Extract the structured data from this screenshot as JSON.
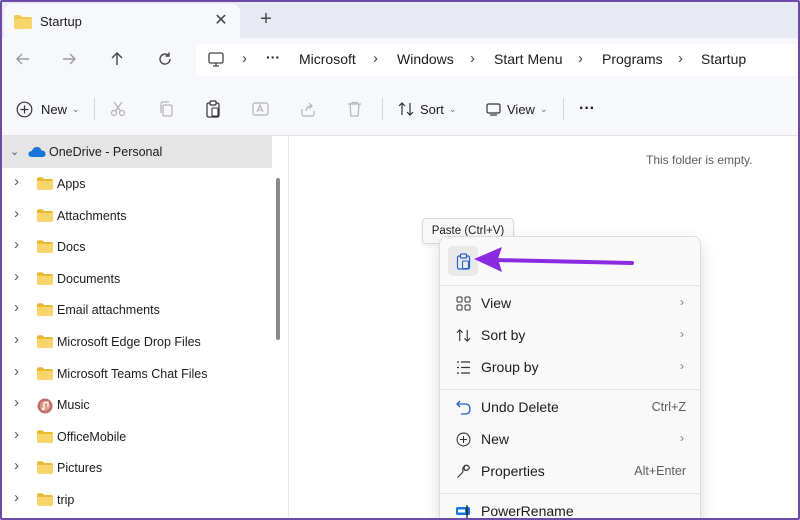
{
  "tab": {
    "title": "Startup",
    "close": "✕",
    "add": "+"
  },
  "nav": {
    "more": "···",
    "breadcrumb": [
      "Microsoft",
      "Windows",
      "Start Menu",
      "Programs",
      "Startup"
    ]
  },
  "toolbar": {
    "new_label": "New",
    "sort_label": "Sort",
    "view_label": "View",
    "more_label": "···"
  },
  "sidebar": {
    "root": "OneDrive - Personal",
    "items": [
      {
        "label": "Apps",
        "icon": "folder-icon"
      },
      {
        "label": "Attachments",
        "icon": "folder-icon"
      },
      {
        "label": "Docs",
        "icon": "folder-icon"
      },
      {
        "label": "Documents",
        "icon": "folder-icon"
      },
      {
        "label": "Email attachments",
        "icon": "folder-icon"
      },
      {
        "label": "Microsoft Edge Drop Files",
        "icon": "folder-icon"
      },
      {
        "label": "Microsoft Teams Chat Files",
        "icon": "folder-icon"
      },
      {
        "label": "Music",
        "icon": "music-icon"
      },
      {
        "label": "OfficeMobile",
        "icon": "folder-icon"
      },
      {
        "label": "Pictures",
        "icon": "folder-icon"
      },
      {
        "label": "trip",
        "icon": "folder-icon"
      }
    ]
  },
  "content": {
    "empty_message": "This folder is empty."
  },
  "tooltip": {
    "text": "Paste (Ctrl+V)"
  },
  "context_menu": {
    "items": [
      {
        "label": "View",
        "submenu": true
      },
      {
        "label": "Sort by",
        "submenu": true
      },
      {
        "label": "Group by",
        "submenu": true
      },
      {
        "label": "Undo Delete",
        "shortcut": "Ctrl+Z"
      },
      {
        "label": "New",
        "submenu": true
      },
      {
        "label": "Properties",
        "shortcut": "Alt+Enter"
      },
      {
        "label": "PowerRename"
      }
    ]
  },
  "colors": {
    "accent_arrow": "#8a2be2",
    "folder": "#f2c94c",
    "onedrive": "#1a73d6",
    "frame_border": "#6b4aa8"
  }
}
